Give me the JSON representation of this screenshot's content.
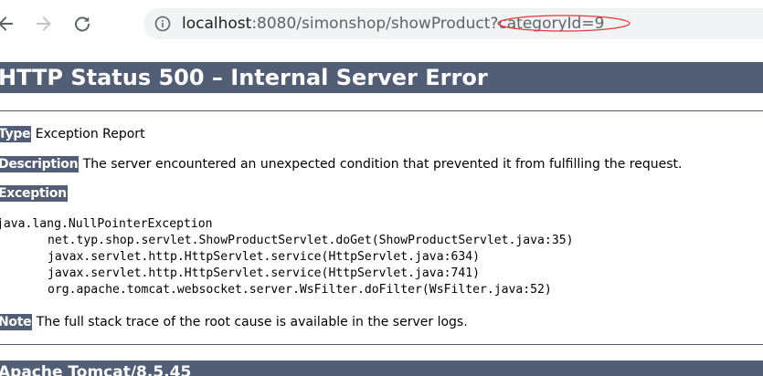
{
  "browser": {
    "url": {
      "host": "localhost",
      "rest": ":8080/simonshop/showProduct?categoryId=9"
    },
    "annotation_color": "#e53935"
  },
  "error_page": {
    "title": "HTTP Status 500 – Internal Server Error",
    "type": {
      "label": "Type",
      "value": " Exception Report"
    },
    "description": {
      "label": "Description",
      "value": " The server encountered an unexpected condition that prevented it from fulfilling the request."
    },
    "exception": {
      "label": "Exception"
    },
    "stack_trace": [
      "java.lang.NullPointerException",
      "net.typ.shop.servlet.ShowProductServlet.doGet(ShowProductServlet.java:35)",
      "javax.servlet.http.HttpServlet.service(HttpServlet.java:634)",
      "javax.servlet.http.HttpServlet.service(HttpServlet.java:741)",
      "org.apache.tomcat.websocket.server.WsFilter.doFilter(WsFilter.java:52)"
    ],
    "note": {
      "label": "Note",
      "value": " The full stack trace of the root cause is available in the server logs."
    },
    "server_info": "Apache Tomcat/8.5.45"
  },
  "theme": {
    "header_bg": "#525d76",
    "header_fg": "#ffffff",
    "address_bar_bg": "#f1f3f4"
  }
}
